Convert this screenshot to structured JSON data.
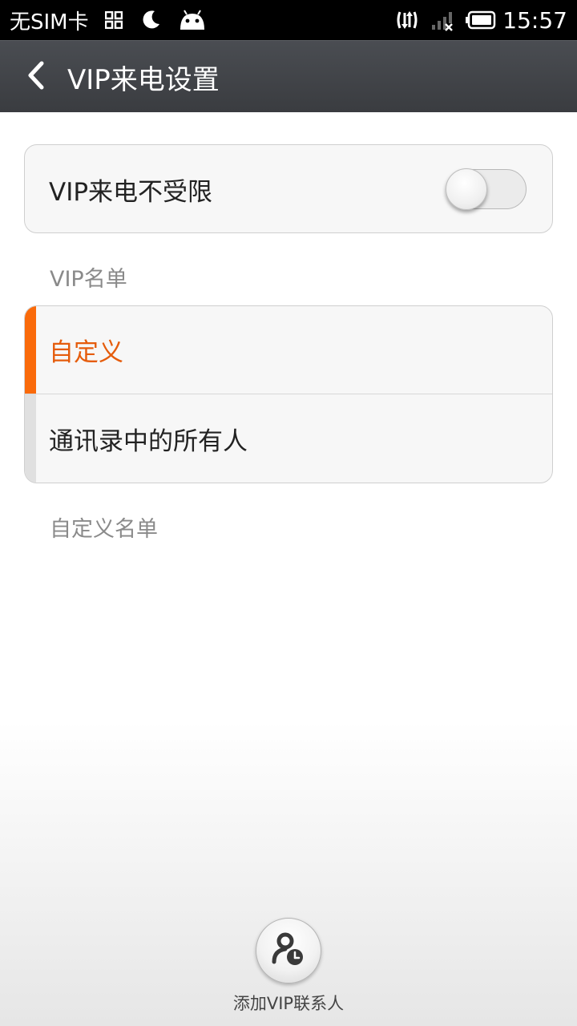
{
  "status_bar": {
    "carrier": "无SIM卡",
    "time": "15:57",
    "icons": [
      "app-grid-icon",
      "moon-icon",
      "android-icon",
      "data-sync-icon",
      "no-signal-icon",
      "battery-icon"
    ]
  },
  "title_bar": {
    "title": "VIP来电设置",
    "back_icon": "chevron-left-icon"
  },
  "vip_toggle": {
    "label": "VIP来电不受限",
    "state": "off"
  },
  "section_vip_list": {
    "header": "VIP名单",
    "options": [
      {
        "label": "自定义",
        "selected": true
      },
      {
        "label": "通讯录中的所有人",
        "selected": false
      }
    ]
  },
  "section_custom_list": {
    "header": "自定义名单"
  },
  "add_vip": {
    "label": "添加VIP联系人",
    "icon": "add-contact-icon"
  },
  "colors": {
    "accent": "#fa6a0a",
    "selected_text": "#e55c0c",
    "title_bar": "#3f4246"
  }
}
